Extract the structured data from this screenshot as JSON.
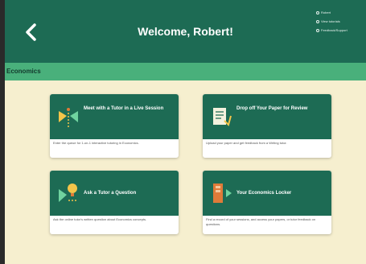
{
  "header": {
    "title": "Welcome, Robert!",
    "menu": [
      {
        "label": "Robert"
      },
      {
        "label": "View tutorials"
      },
      {
        "label": "Feedback/Support"
      }
    ]
  },
  "subheader": {
    "label": "Economics"
  },
  "cards": [
    {
      "icon": "tutor-session-icon",
      "title": "Meet with a Tutor in a Live Session",
      "description": "Enter the queue for 1-on-1 interactive tutoring in Economics."
    },
    {
      "icon": "paper-review-icon",
      "title": "Drop off Your Paper for Review",
      "description": "Upload your paper and get feedback from a Writing tutor."
    },
    {
      "icon": "question-bulb-icon",
      "title": "Ask a Tutor a Question",
      "description": "Ask the online tutor's written question about Economics concepts."
    },
    {
      "icon": "locker-icon",
      "title": "Your Economics Locker",
      "description": "Find a record of your sessions, and access your papers, or tutor feedback on questions."
    }
  ],
  "colors": {
    "header": "#1d6b54",
    "subheader": "#49b07b",
    "background": "#f6efcf",
    "card_head": "#1d6b54",
    "accent_yellow": "#f4c54a",
    "accent_orange": "#e07b39"
  }
}
